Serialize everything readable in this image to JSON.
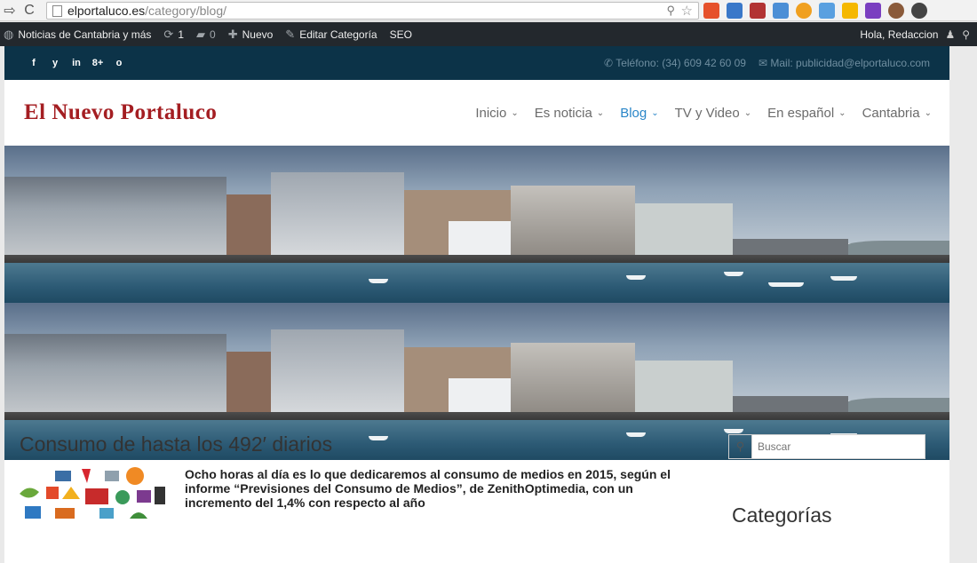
{
  "browser": {
    "url_host": "elportaluco.es",
    "url_path": "/category/blog/"
  },
  "wp_bar": {
    "site_name": "Noticias de Cantabria y más",
    "updates_count": "1",
    "comments_count": "0",
    "new_label": "Nuevo",
    "edit_label": "Editar Categoría",
    "seo_label": "SEO",
    "greeting": "Hola, Redaccion"
  },
  "topbar": {
    "social": [
      "f",
      "y",
      "in",
      "8+",
      "o"
    ],
    "phone": "Teléfono: (34) 609 42 60 09",
    "mail": "Mail: publicidad@elportaluco.com"
  },
  "header": {
    "logo": "El Nuevo Portaluco",
    "menu": [
      {
        "label": "Inicio",
        "active": false
      },
      {
        "label": "Es noticia",
        "active": false
      },
      {
        "label": "Blog",
        "active": true
      },
      {
        "label": "TV y Video",
        "active": false
      },
      {
        "label": "En español",
        "active": false
      },
      {
        "label": "Cantabria",
        "active": false
      }
    ]
  },
  "post": {
    "title": "Consumo de hasta los 492′ diarios",
    "excerpt": "Ocho horas al día es lo que dedicaremos al consumo de medios en 2015, según el informe “Previsiones del Consumo de Medios”, de ZenithOptimedia, con un incremento del 1,4% con respecto al año"
  },
  "sidebar": {
    "search_placeholder": "Buscar",
    "categories_title": "Categorías"
  },
  "colors": {
    "admin_bar": "#23282d",
    "topbar": "#0c3348",
    "logo": "#a41e22",
    "menu_active": "#2a86c8"
  }
}
